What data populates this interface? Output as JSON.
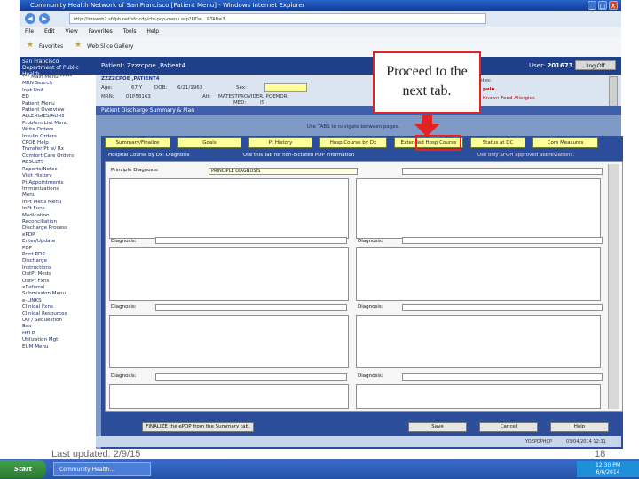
{
  "window": {
    "title": "Community Health Network of San Francisco [Patient Menu] - Windows Internet Explorer",
    "address": "http://lcrsweb2.sfdph.net/sfc-cdp/chr-pdp-menu.asp?PID=...&TAB=3",
    "min": "_",
    "max": "□",
    "close": "X"
  },
  "menubar": [
    "File",
    "Edit",
    "View",
    "Favorites",
    "Tools",
    "Help"
  ],
  "favbar": {
    "favorites": "Favorites",
    "gallery": "Web Slice Gallery"
  },
  "left_nav": {
    "brand_line1": "San Francisco",
    "brand_line2": "Department of Public Health",
    "items": [
      "*** Main Menu *****",
      "MRN Search",
      "Inpt Unit",
      "ED",
      "Patient Menu",
      "Patient Overview",
      "ALLERGIES/ADRs",
      "Problem List Menu",
      "Write Orders",
      "Insulin Orders",
      "CPOE Help",
      "Transfer Pt w/ Rx",
      "Comfort Care Orders",
      "RESULTS",
      "Reports/Notes",
      "Visit History",
      "Pt Appointments",
      "Immunizations",
      "Menu",
      "InPt Meds Menu",
      "InPt Fxns",
      "Medication",
      "Reconciliation",
      "Discharge Process",
      "ePDP",
      "Enter/Update",
      "PDP",
      "Print PDP",
      "Discharge",
      "Instructions",
      "OutPt Meds",
      "OutPt Fxns",
      "eReferral",
      "Submission Menu",
      "e-LINKS",
      "Clinical Fxns",
      "Clinical Resources",
      "UO / Sequestion",
      "Box",
      "HELP",
      "Utilization Mgt",
      "EUM Menu"
    ]
  },
  "header": {
    "patient_label": "Patient:",
    "patient_name": "Zzzzcpoe ,Patient4",
    "user_label": "User:",
    "user_id": "201673",
    "logoff": "Log Off"
  },
  "info": {
    "line1": "ZZZZCPOE ,PATIENT4",
    "age_label": "Age:",
    "age": "67 Y",
    "dob_label": "DOB:",
    "dob": "6/21/1963",
    "sex_label": "Sex:",
    "mrn_label": "MRN:",
    "mrn": "01P58163",
    "attending_label": "Att:",
    "attending": "MATESTPROVIDER, POEMDR:",
    "med_label": "MED:",
    "med_value": "IS",
    "alert_label": "Notes:",
    "alert_value": "pain",
    "allergy": "Known Food Allergies"
  },
  "page_title": "Patient Discharge Summary & Plan",
  "tabs_hint": "Use TABS to navigate between pages.",
  "tabs": [
    "Summary/Finalize",
    "Goals",
    "Pt History",
    "Hosp Course by Dx",
    "Extended Hosp Course",
    "Status at DC",
    "Core Measures"
  ],
  "section": {
    "col1": "Hospital Course by Dx: Diagnosis",
    "col2": "Use this Tab for non-dictated PDP information",
    "note": "Use only SFGH approved abbreviations."
  },
  "form": {
    "principle_label": "Principle Diagnosis:",
    "principle_value": "PRINCIPLE DIAGNOSIS",
    "diagnosis_label": "Diagnosis:"
  },
  "buttons": {
    "finalize": "FINALIZE the ePDP from the Summary tab.",
    "save": "Save",
    "cancel": "Cancel",
    "help": "Help"
  },
  "status": {
    "user_code": "YOEPDPHCP",
    "datetime": "03/04/2014 12:31"
  },
  "taskbar": {
    "start": "Start",
    "task1": "Community Health...",
    "time": "12:30 PM",
    "date": "6/6/2014"
  },
  "callout": {
    "text": "Proceed to the next tab."
  },
  "slide": {
    "last_updated": "Last updated: 2/9/15",
    "page_number": "18"
  }
}
